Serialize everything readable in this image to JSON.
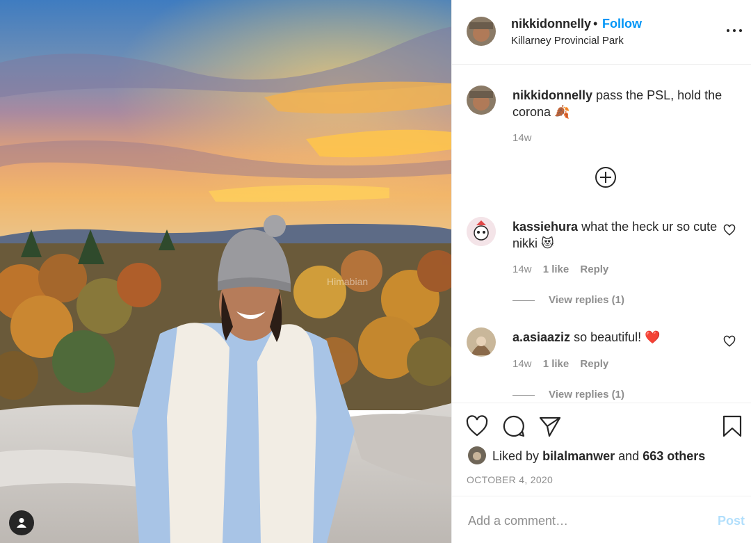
{
  "post": {
    "username": "nikkidonnelly",
    "dot": "•",
    "follow_label": "Follow",
    "location": "Killarney Provincial Park",
    "watermark_text": "Himabian"
  },
  "caption": {
    "username": "nikkidonnelly",
    "text": "pass the PSL, hold the corona 🍂",
    "time": "14w"
  },
  "comments": [
    {
      "username": "kassiehura",
      "text": "what the heck ur so cute nikki 😻",
      "time": "14w",
      "likes": "1 like",
      "reply": "Reply",
      "view_replies": "View replies (1)"
    },
    {
      "username": "a.asiaaziz",
      "text": "so beautiful! ❤️",
      "time": "14w",
      "likes": "1 like",
      "reply": "Reply",
      "view_replies": "View replies (1)"
    }
  ],
  "likes": {
    "prefix": "Liked by",
    "user": "bilalmanwer",
    "middle": "and",
    "others": "663 others"
  },
  "date": "OCTOBER 4, 2020",
  "add_comment": {
    "placeholder": "Add a comment…",
    "post_label": "Post"
  },
  "colors": {
    "accent": "#0095f6",
    "post_disabled": "#b2dffc",
    "text": "#262626",
    "muted": "#8e8e8e"
  }
}
